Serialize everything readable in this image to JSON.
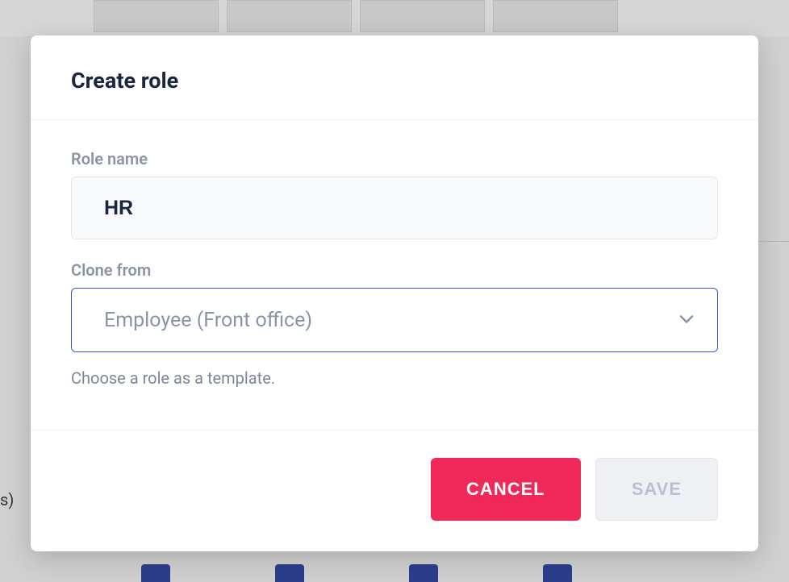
{
  "modal": {
    "title": "Create role",
    "fields": {
      "role_name": {
        "label": "Role name",
        "value": "HR"
      },
      "clone_from": {
        "label": "Clone from",
        "selected": "Employee (Front office)",
        "helper": "Choose a role as a template."
      }
    },
    "actions": {
      "cancel": "CANCEL",
      "save": "SAVE"
    }
  },
  "background": {
    "left_fragment": "s)"
  }
}
